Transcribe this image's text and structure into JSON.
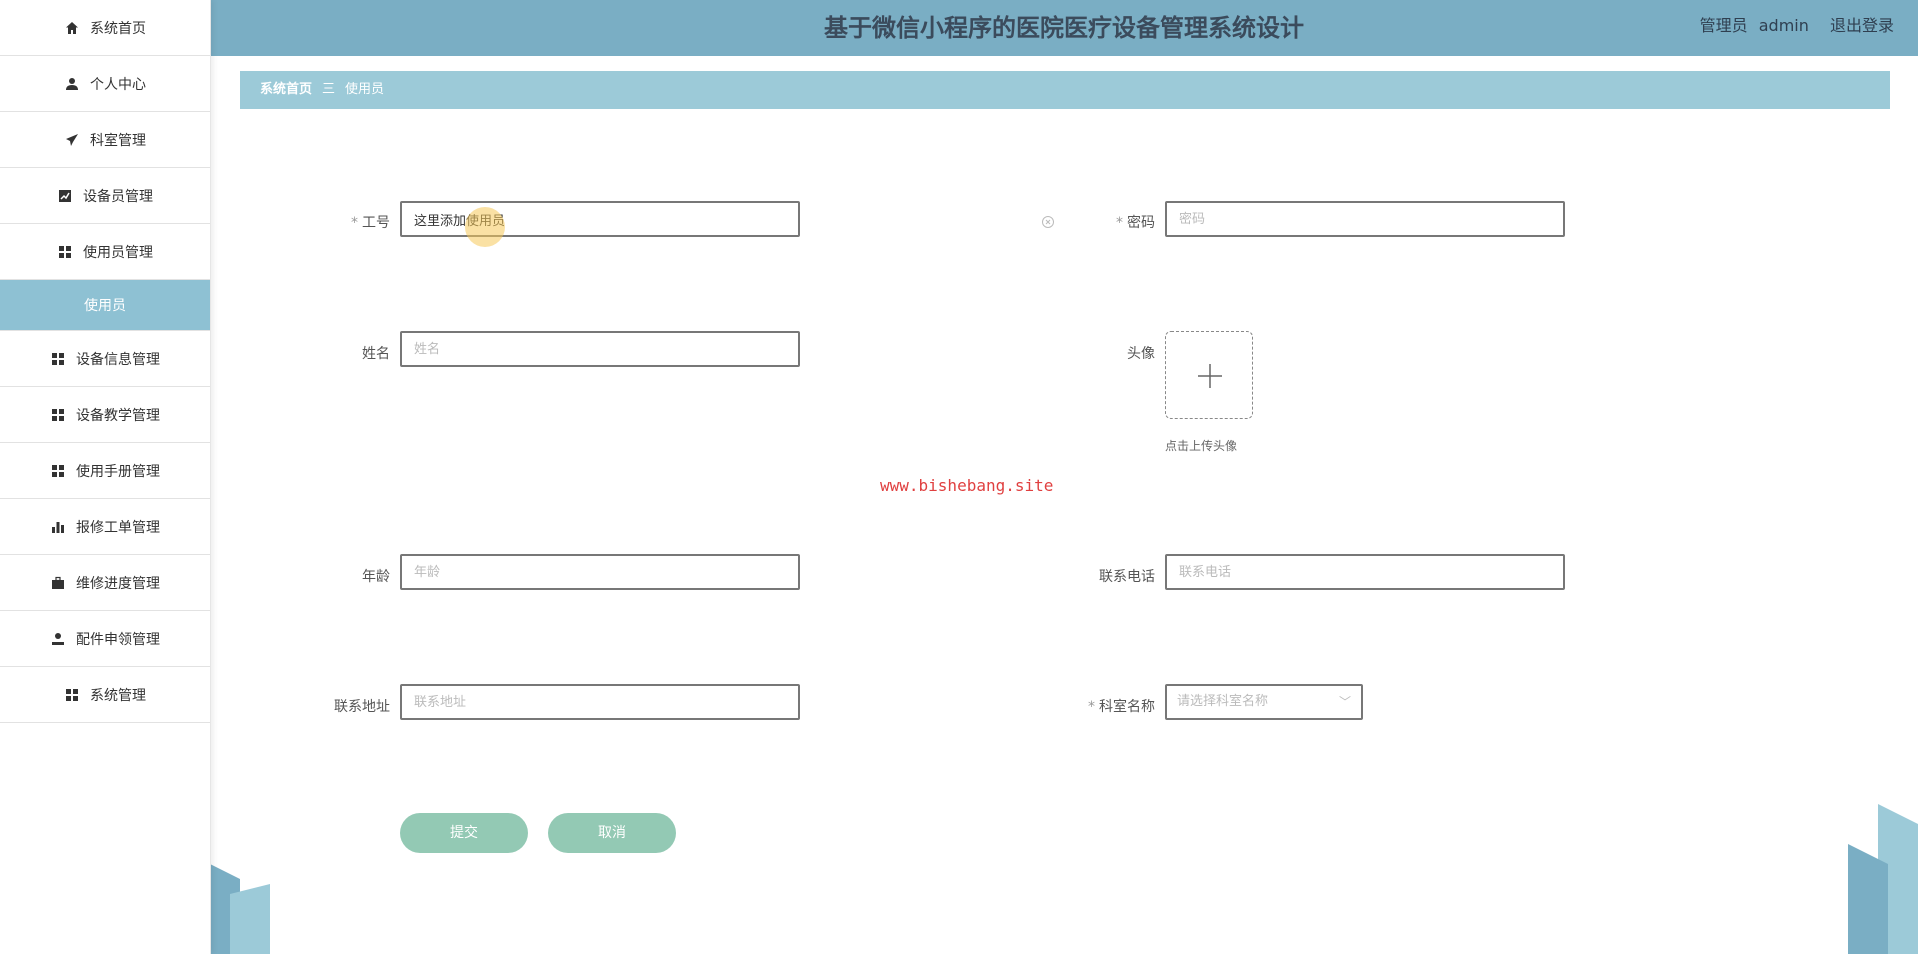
{
  "sidebar": {
    "items": [
      {
        "label": "系统首页",
        "icon": "home-icon"
      },
      {
        "label": "个人中心",
        "icon": "user-icon"
      },
      {
        "label": "科室管理",
        "icon": "paper-plane-icon"
      },
      {
        "label": "设备员管理",
        "icon": "chart-icon"
      },
      {
        "label": "使用员管理",
        "icon": "grid-icon"
      },
      {
        "label": "使用员",
        "icon": ""
      },
      {
        "label": "设备信息管理",
        "icon": "grid-icon"
      },
      {
        "label": "设备教学管理",
        "icon": "grid-icon"
      },
      {
        "label": "使用手册管理",
        "icon": "grid-icon"
      },
      {
        "label": "报修工单管理",
        "icon": "bar-chart-icon"
      },
      {
        "label": "维修进度管理",
        "icon": "briefcase-icon"
      },
      {
        "label": "配件申领管理",
        "icon": "person-icon"
      },
      {
        "label": "系统管理",
        "icon": "grid-icon"
      }
    ]
  },
  "header": {
    "title": "基于微信小程序的医院医疗设备管理系统设计",
    "role": "管理员",
    "username": "admin",
    "logout": "退出登录"
  },
  "breadcrumb": {
    "home": "系统首页",
    "separator": "三",
    "current": "使用员"
  },
  "form": {
    "gonghao": {
      "label": "工号",
      "value": "这里添加使用员"
    },
    "mima": {
      "label": "密码",
      "placeholder": "密码"
    },
    "xingming": {
      "label": "姓名",
      "placeholder": "姓名"
    },
    "touxiang": {
      "label": "头像",
      "hint": "点击上传头像"
    },
    "nianling": {
      "label": "年龄",
      "placeholder": "年龄"
    },
    "dianhua": {
      "label": "联系电话",
      "placeholder": "联系电话"
    },
    "dizhi": {
      "label": "联系地址",
      "placeholder": "联系地址"
    },
    "keshi": {
      "label": "科室名称",
      "placeholder": "请选择科室名称"
    },
    "submit": "提交",
    "cancel": "取消"
  },
  "watermark": "www.bishebang.site",
  "colors": {
    "header": "#7aaec4",
    "breadcrumb": "#9ccad8",
    "active_menu": "#8ec1d3",
    "button": "#93c9b4"
  }
}
